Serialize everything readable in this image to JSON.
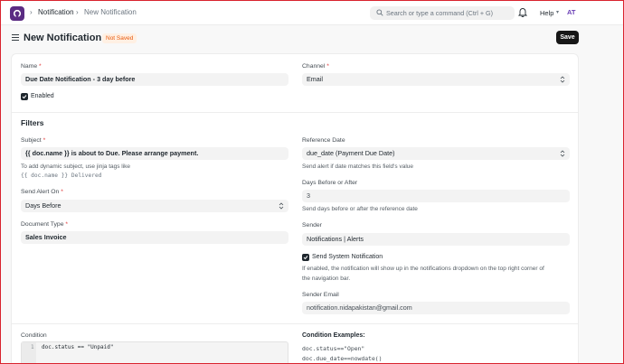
{
  "navbar": {
    "breadcrumb": [
      "Notification",
      "New Notification"
    ],
    "search_placeholder": "Search or type a command (Ctrl + G)",
    "help_label": "Help",
    "avatar_initials": "AT"
  },
  "header": {
    "title": "New Notification",
    "status_badge": "Not Saved",
    "save_label": "Save"
  },
  "form": {
    "name": {
      "label": "Name",
      "value": "Due Date Notification - 3 day before"
    },
    "channel": {
      "label": "Channel",
      "value": "Email"
    },
    "enabled": {
      "label": "Enabled",
      "checked": true
    },
    "filters_title": "Filters",
    "subject": {
      "label": "Subject",
      "value": "{{ doc.name }} is about to Due. Please arrange payment.",
      "hint": "To add dynamic subject, use jinja tags like",
      "hint_code": "{{ doc.name }} Delivered"
    },
    "reference_date": {
      "label": "Reference Date",
      "value": "due_date (Payment Due Date)",
      "hint": "Send alert if date matches this field's value"
    },
    "days_before_after": {
      "label": "Days Before or After",
      "value": "3",
      "hint": "Send days before or after the reference date"
    },
    "send_alert_on": {
      "label": "Send Alert On",
      "value": "Days Before"
    },
    "sender": {
      "label": "Sender",
      "value": "Notifications | Alerts"
    },
    "document_type": {
      "label": "Document Type",
      "value": "Sales Invoice"
    },
    "send_system_notification": {
      "label": "Send System Notification",
      "checked": true,
      "hint_line1": "If enabled, the notification will show up in the notifications dropdown on the top right corner of",
      "hint_line2": "the navigation bar."
    },
    "sender_email": {
      "label": "Sender Email",
      "value": "notification.nidapakistan@gmail.com"
    },
    "condition": {
      "label": "Condition",
      "line_number": "1",
      "code": "doc.status == \"Unpaid\""
    },
    "condition_examples": {
      "title": "Condition Examples:",
      "items": [
        "doc.status==\"Open\"",
        "doc.due_date==nowdate()"
      ]
    }
  },
  "colors": {
    "brand": "#5b2c83",
    "badge_text": "#e8590c",
    "badge_bg": "#fff0e3",
    "primary_button": "#171717",
    "frame_border": "#d9232e"
  }
}
